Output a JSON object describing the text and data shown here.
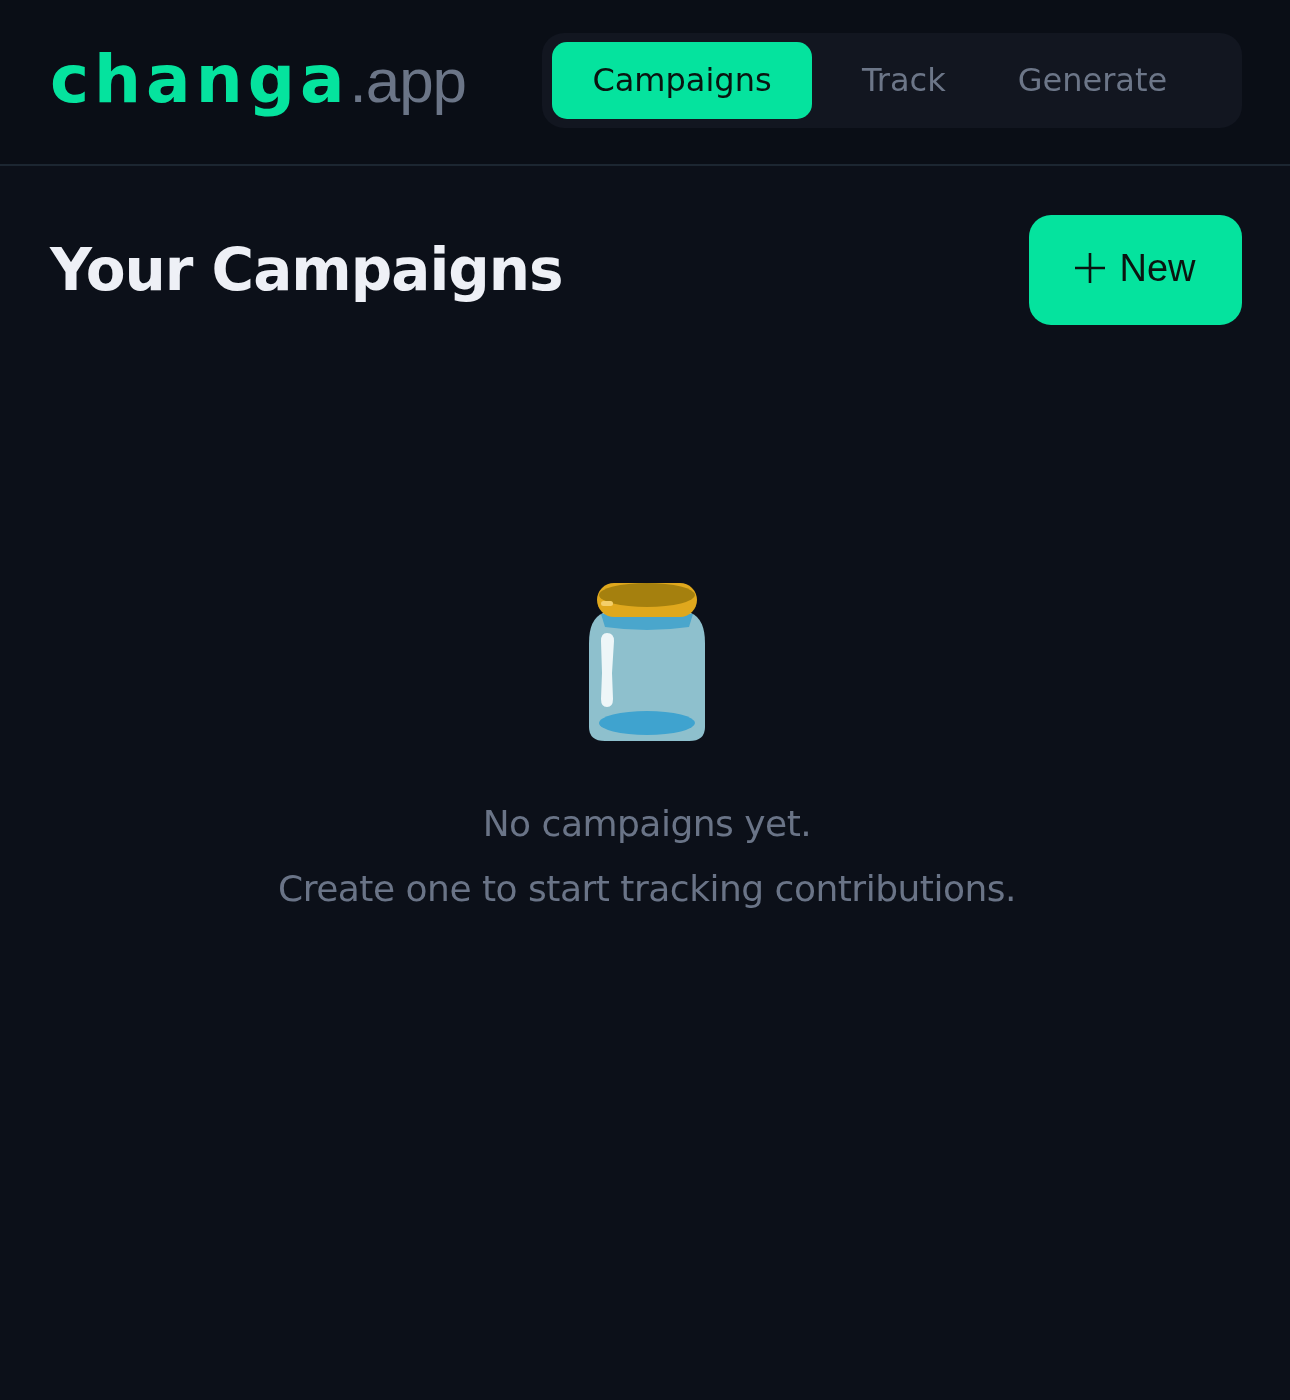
{
  "logo": {
    "text": "**changa**.app"
  },
  "nav": {
    "tabs": [
      {
        "label": "Campaigns",
        "selected": true
      },
      {
        "label": "Track",
        "selected": false
      },
      {
        "label": "Generate",
        "selected": false
      }
    ]
  },
  "page": {
    "title": "Your Campaigns",
    "new_button": {
      "label": "New"
    }
  },
  "empty_state": {
    "lines": [
      "No campaigns yet.",
      "Create one to start tracking contributions."
    ]
  }
}
